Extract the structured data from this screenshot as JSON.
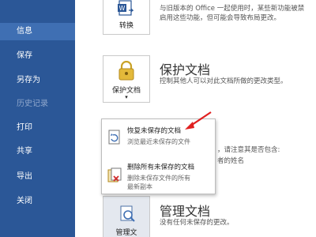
{
  "sidebar": {
    "items": [
      {
        "label": "信息"
      },
      {
        "label": "保存"
      },
      {
        "label": "另存为"
      },
      {
        "label": "历史记录"
      },
      {
        "label": "打印"
      },
      {
        "label": "共享"
      },
      {
        "label": "导出"
      },
      {
        "label": "关闭"
      }
    ]
  },
  "convert": {
    "label": "转换",
    "desc_line1": "与旧版本的 Office 一起使用时，某些新功能被禁",
    "desc_line2": "启用这些功能，但可能会导致布局更改。"
  },
  "protect": {
    "title": "保护文档",
    "tile_label": "保护文档",
    "desc": "控制其他人可以对此文档所做的更改类型。"
  },
  "inspect": {
    "desc_line1": "，请注意其是否包含:",
    "desc_line2": "者的姓名"
  },
  "manage": {
    "title": "管理文档",
    "tile_label": "管理文",
    "desc": "没有任何未保存的更改。"
  },
  "menu": {
    "items": [
      {
        "title": "恢复未保存的文档",
        "desc": "浏览最近未保存的文件"
      },
      {
        "title": "删除所有未保存的文档",
        "desc_line1": "删除未保存文件的所有",
        "desc_line2": "最新副本"
      }
    ]
  },
  "colors": {
    "sidebar": "#2b5797",
    "sidebar_active": "#3f6fb3",
    "arrow": "#e02020"
  }
}
